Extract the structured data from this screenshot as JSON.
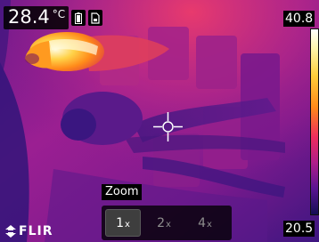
{
  "measurement": {
    "spot_temperature": "28.4",
    "unit": "°C"
  },
  "status_icons": [
    "battery-icon",
    "sd-card-icon"
  ],
  "scale": {
    "max": "40.8",
    "min": "20.5",
    "palette": "iron"
  },
  "zoom": {
    "label": "Zoom",
    "options": [
      {
        "value": "1",
        "suffix": "x"
      },
      {
        "value": "2",
        "suffix": "x"
      },
      {
        "value": "4",
        "suffix": "x"
      }
    ],
    "selected": "1x"
  },
  "brand": {
    "logo_text": "FLIR"
  },
  "colors": {
    "cold": "#1a0f5e",
    "mid": "#b01e8a",
    "hot": "#ff8a1a",
    "hottest": "#fffbe0"
  }
}
